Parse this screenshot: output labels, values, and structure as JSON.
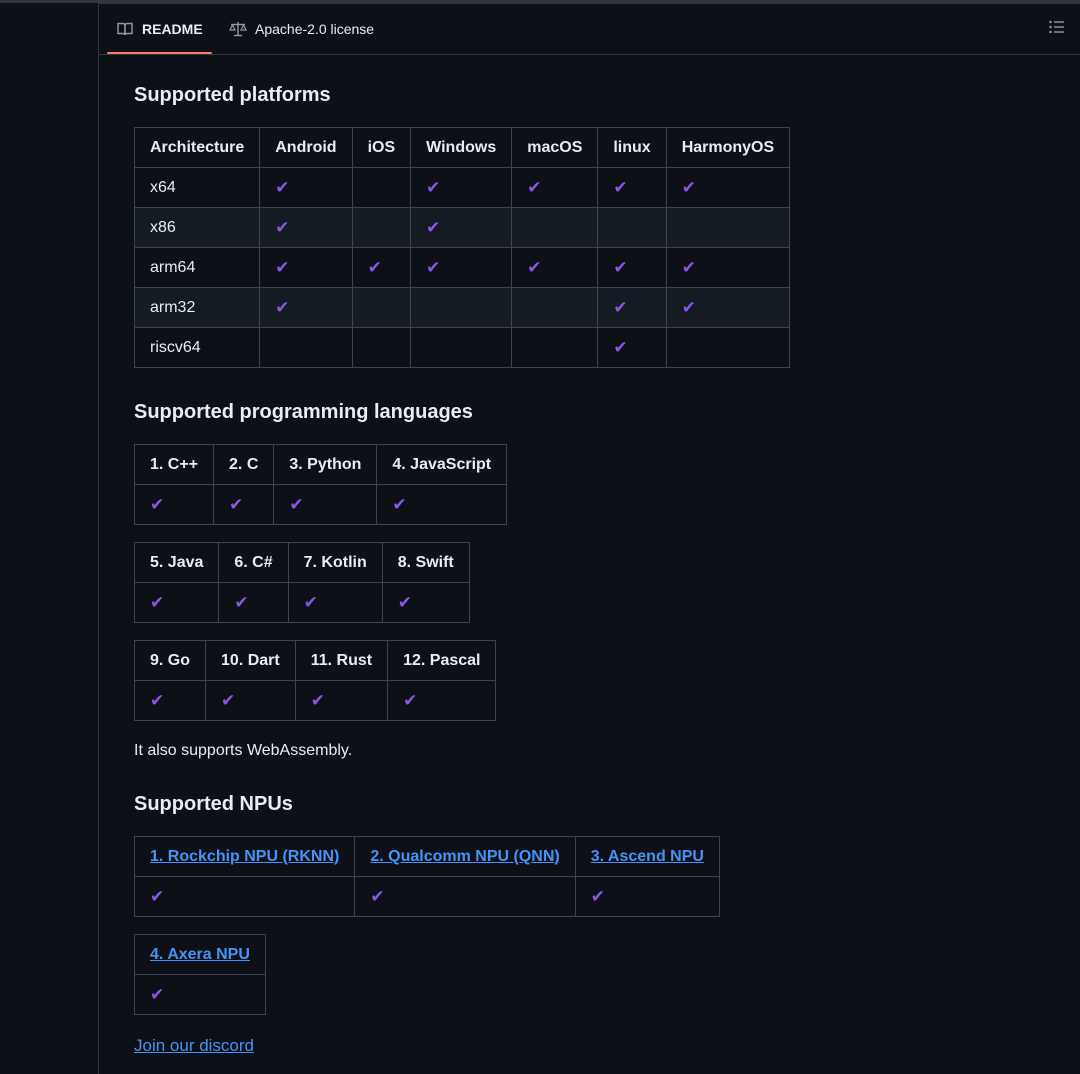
{
  "tabs": {
    "readme_label": "README",
    "license_label": "Apache-2.0 license"
  },
  "platforms": {
    "heading": "Supported platforms",
    "headers": [
      "Architecture",
      "Android",
      "iOS",
      "Windows",
      "macOS",
      "linux",
      "HarmonyOS"
    ],
    "rows": [
      {
        "arch": "x64",
        "support": [
          true,
          false,
          true,
          true,
          true,
          true
        ]
      },
      {
        "arch": "x86",
        "support": [
          true,
          false,
          true,
          false,
          false,
          false
        ]
      },
      {
        "arch": "arm64",
        "support": [
          true,
          true,
          true,
          true,
          true,
          true
        ]
      },
      {
        "arch": "arm32",
        "support": [
          true,
          false,
          false,
          false,
          true,
          true
        ]
      },
      {
        "arch": "riscv64",
        "support": [
          false,
          false,
          false,
          false,
          true,
          false
        ]
      }
    ]
  },
  "languages": {
    "heading": "Supported programming languages",
    "tables": [
      [
        "1. C++",
        "2. C",
        "3. Python",
        "4. JavaScript"
      ],
      [
        "5. Java",
        "6. C#",
        "7. Kotlin",
        "8. Swift"
      ],
      [
        "9. Go",
        "10. Dart",
        "11. Rust",
        "12. Pascal"
      ]
    ],
    "note": "It also supports WebAssembly."
  },
  "npus": {
    "heading": "Supported NPUs",
    "tables": [
      [
        "1. Rockchip NPU (RKNN)",
        "2. Qualcomm NPU (QNN)",
        "3. Ascend NPU"
      ],
      [
        "4. Axera NPU"
      ]
    ]
  },
  "discord_link": "Join our discord",
  "check_glyph": "✔",
  "icons": {
    "readme": "book-icon",
    "license": "law-scale-icon",
    "toc": "list-unordered-icon"
  },
  "colors": {
    "check": "#8957e5",
    "link": "#4493f8",
    "tab_underline": "#f78166",
    "background": "#0d1117"
  }
}
